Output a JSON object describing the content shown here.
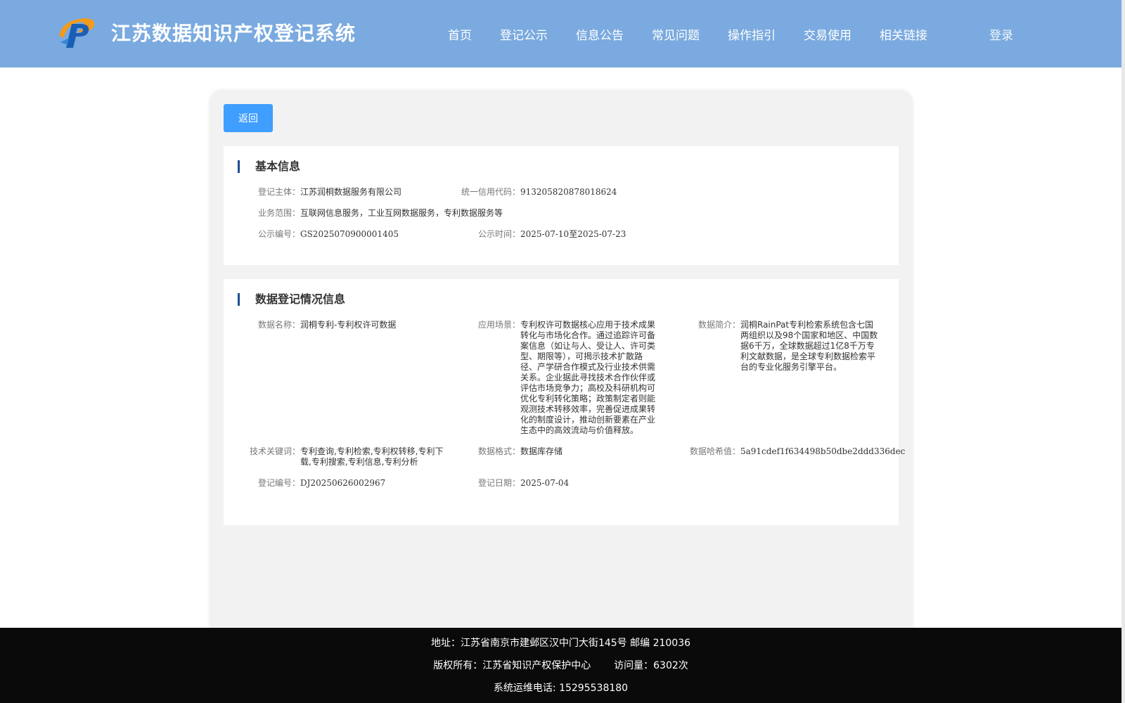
{
  "header": {
    "site_title": "江苏数据知识产权登记系统",
    "nav": [
      "首页",
      "登记公示",
      "信息公告",
      "常见问题",
      "操作指引",
      "交易使用",
      "相关链接"
    ],
    "login": "登录",
    "colors": {
      "header_bg": "#7aaadf",
      "accent": "#409eff"
    }
  },
  "toolbar": {
    "back_label": "返回"
  },
  "basic_info": {
    "title": "基本信息",
    "subject_label": "登记主体：",
    "subject_value": "江苏润桐数据服务有限公司",
    "credit_label": "统一信用代码：",
    "credit_value": "913205820878018624",
    "scope_label": "业务范围：",
    "scope_value": "互联网信息服务，工业互网数据服务，专利数据服务等",
    "pub_no_label": "公示编号：",
    "pub_no_value": "GS2025070900001405",
    "pub_time_label": "公示时间：",
    "pub_time_value": "2025-07-10至2025-07-23"
  },
  "data_info": {
    "title": "数据登记情况信息",
    "name_label": "数据名称：",
    "name_value": "润桐专利-专利权许可数据",
    "scene_label": "应用场景：",
    "scene_value": "专利权许可数据核心应用于技术成果转化与市场化合作。通过追踪许可备案信息（如让与人、受让人、许可类型、期限等），可揭示技术扩散路径、产学研合作模式及行业技术供需关系。企业据此寻找技术合作伙伴或评估市场竞争力；高校及科研机构可优化专利转化策略；政策制定者则能观测技术转移效率，完善促进成果转化的制度设计，推动创新要素在产业生态中的高效流动与价值释放。",
    "intro_label": "数据简介：",
    "intro_value": "润桐RainPat专利检索系统包含七国两组织以及98个国家和地区、中国数据6千万，全球数据超过1亿8千万专利文献数据，是全球专利数据检索平台的专业化服务引擎平台。",
    "keywords_label": "技术关键词：",
    "keywords_value": "专利查询,专利检索,专利权转移,专利下载,专利搜索,专利信息,专利分析",
    "format_label": "数据格式：",
    "format_value": "数据库存储",
    "hash_label": "数据哈希值：",
    "hash_value": "5a91cdef1f634498b50dbe2ddd336dec",
    "reg_no_label": "登记编号：",
    "reg_no_value": "DJ20250626002967",
    "reg_date_label": "登记日期：",
    "reg_date_value": "2025-07-04"
  },
  "footer": {
    "address": "地址：江苏省南京市建邺区汉中门大街145号 邮编 210036",
    "copyright": "版权所有：江苏省知识产权保护中心",
    "visits": "访问量：6302次",
    "hotline": "系统运维电话: 15295538180"
  }
}
